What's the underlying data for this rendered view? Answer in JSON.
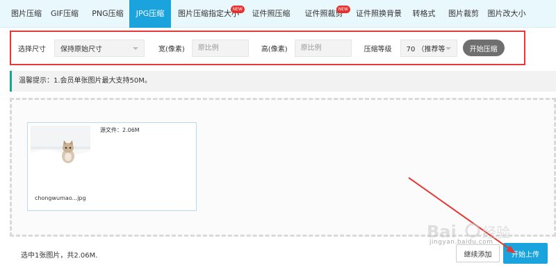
{
  "tabs": [
    {
      "label": "图片压缩",
      "active": false,
      "badge": ""
    },
    {
      "label": "GIF压缩",
      "active": false,
      "badge": ""
    },
    {
      "label": "PNG压缩",
      "active": false,
      "badge": ""
    },
    {
      "label": "JPG压缩",
      "active": true,
      "badge": ""
    },
    {
      "label": "图片压缩指定大小",
      "active": false,
      "badge": "NEW"
    },
    {
      "label": "证件照压缩",
      "active": false,
      "badge": ""
    },
    {
      "label": "证件照裁剪",
      "active": false,
      "badge": "NEW"
    },
    {
      "label": "证件照换背景",
      "active": false,
      "badge": ""
    },
    {
      "label": "转格式",
      "active": false,
      "badge": ""
    },
    {
      "label": "图片裁剪",
      "active": false,
      "badge": ""
    },
    {
      "label": "图片改大小",
      "active": false,
      "badge": ""
    }
  ],
  "settings": {
    "size_label": "选择尺寸",
    "size_value": "保持原始尺寸",
    "width_label": "宽(像素)",
    "width_placeholder": "原比例",
    "height_label": "高(像素)",
    "height_placeholder": "原比例",
    "level_label": "压缩等级",
    "level_value": "70 （推荐等",
    "start_button": "开始压缩"
  },
  "tip": "温馨提示：1.会员单张图片最大支持50M。",
  "file": {
    "size_text": "源文件：2.06M",
    "name": "chongwumao...jpg",
    "thumb_icon": "cat-photo-thumbnail"
  },
  "footer": {
    "summary": "选中1张图片，共2.06M.",
    "continue_button": "继续添加",
    "upload_button": "开始上传"
  },
  "watermark": {
    "text": "jingyan.baidu.com"
  },
  "colors": {
    "accent": "#1aa3dd",
    "highlight_border": "#e53935",
    "badge": "#e9302d",
    "tip_bar": "#1aa38c"
  }
}
